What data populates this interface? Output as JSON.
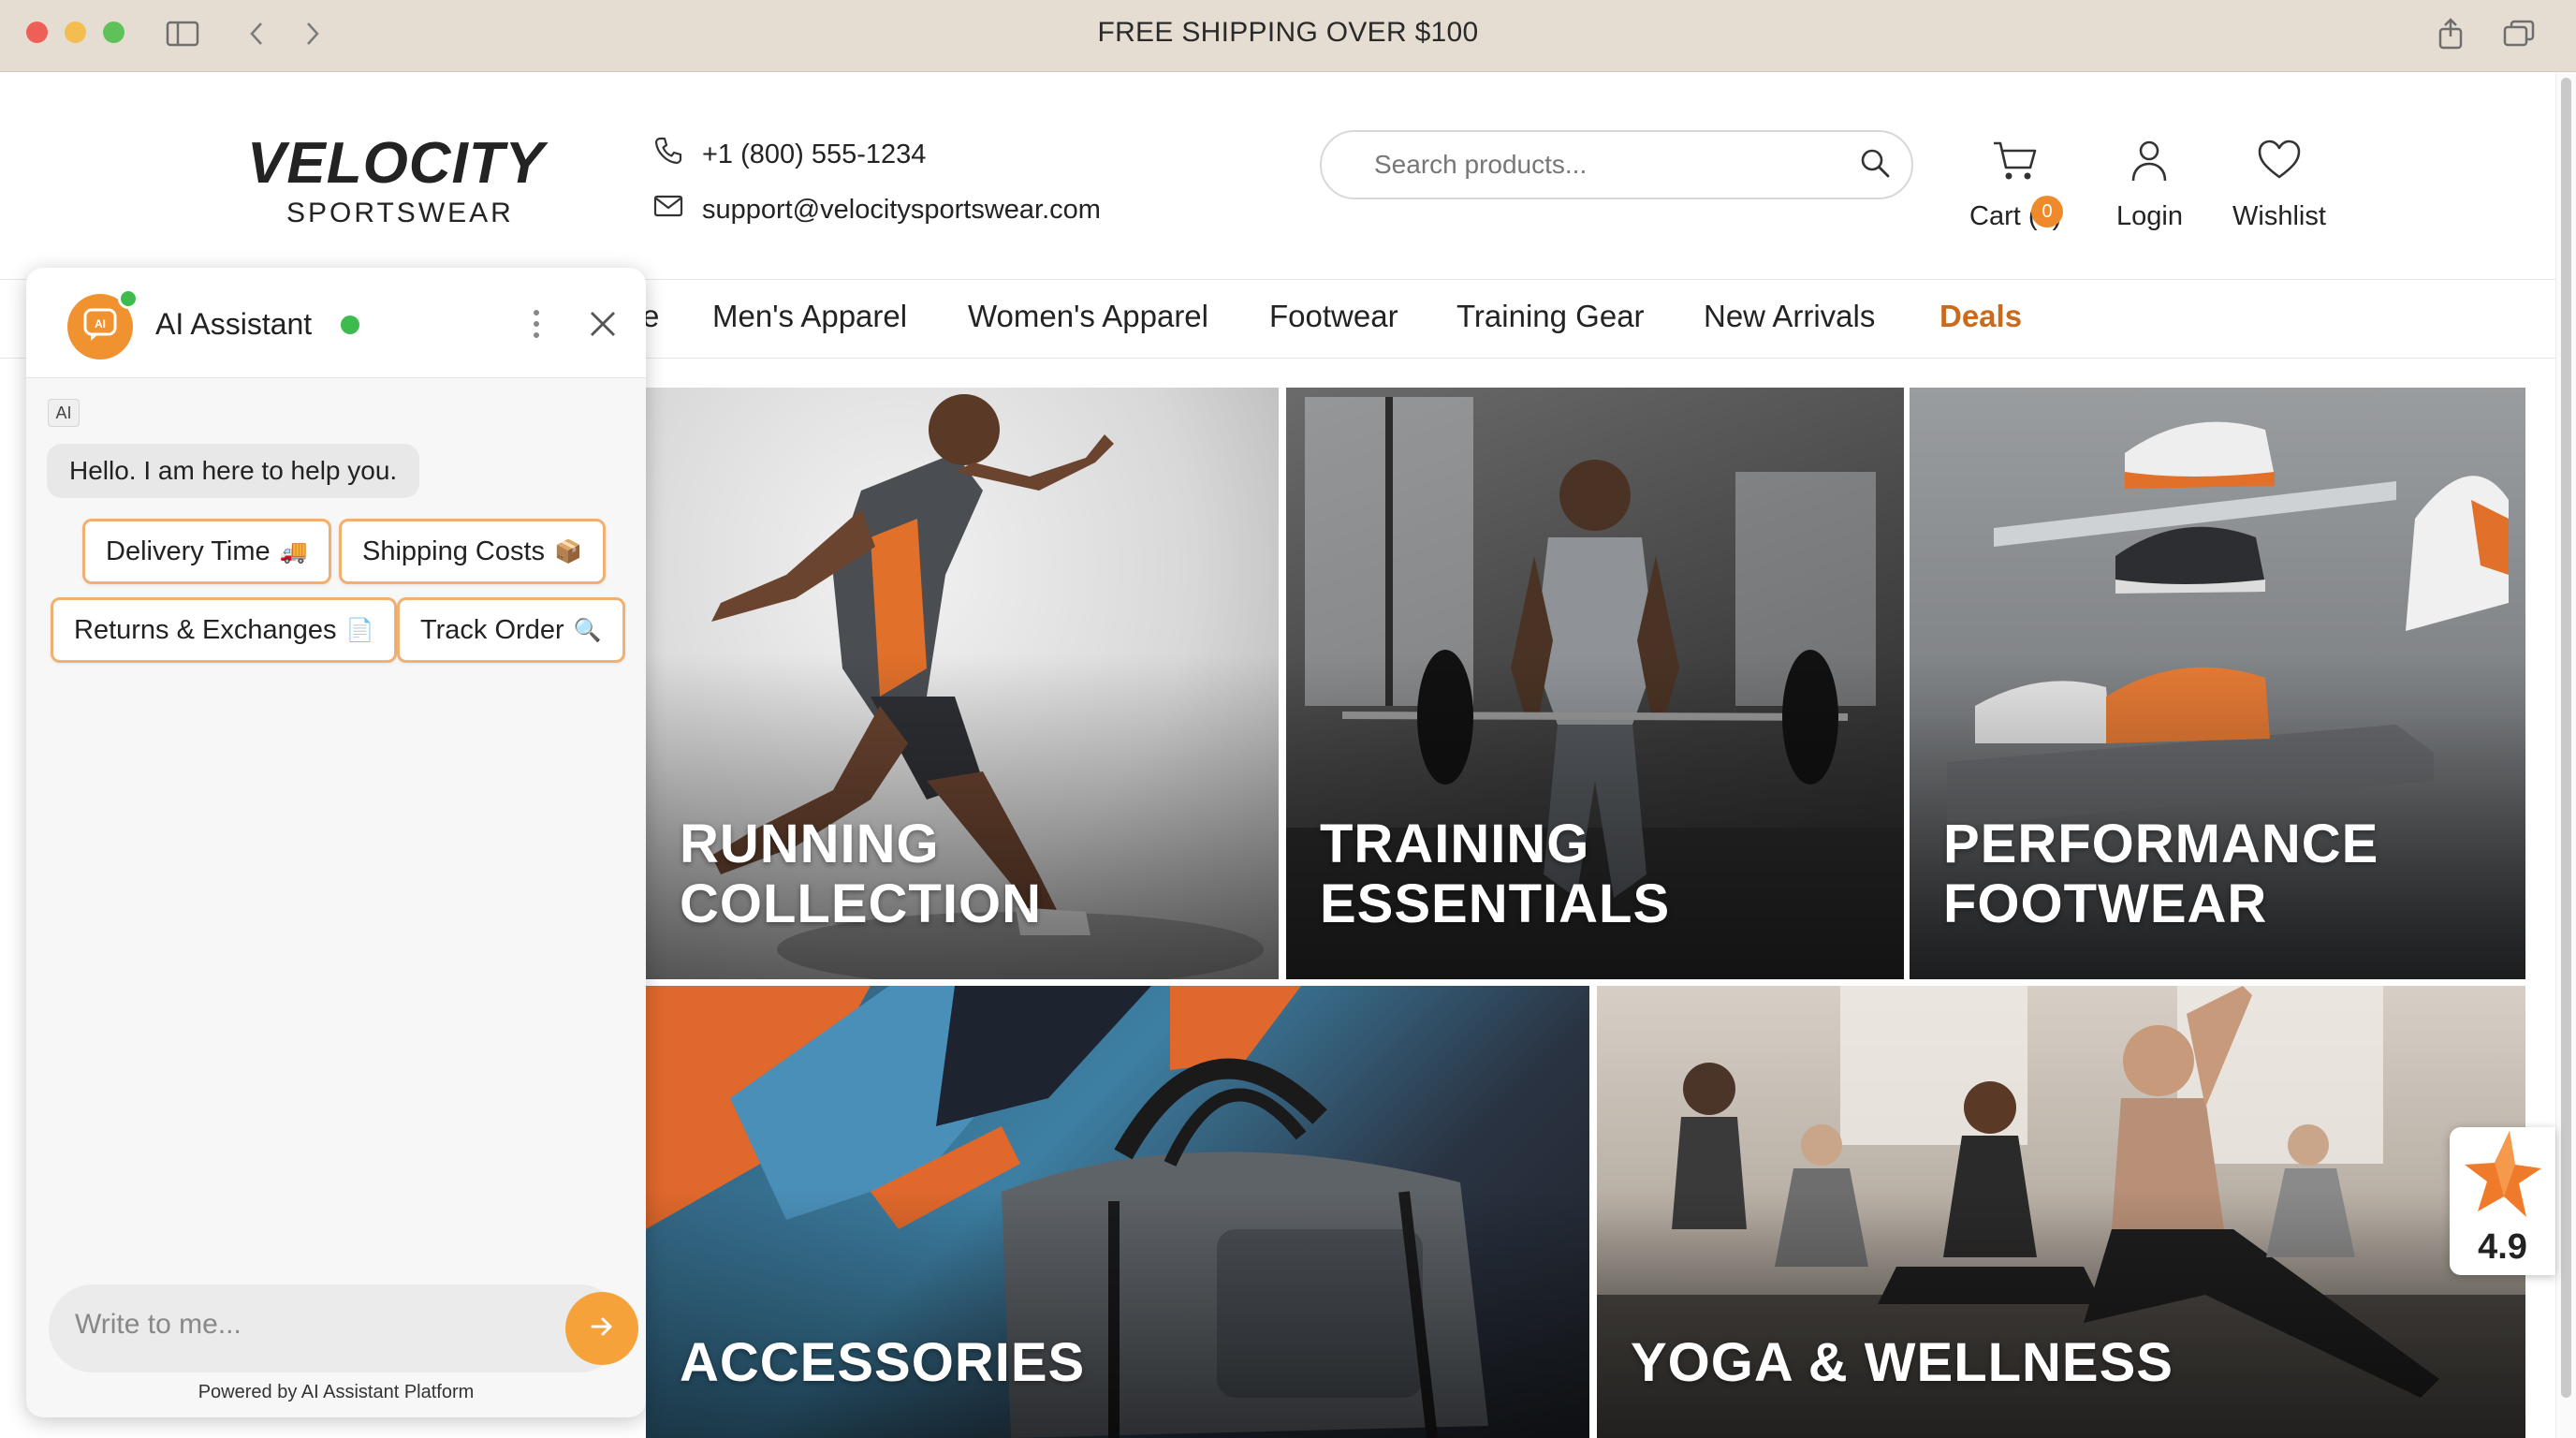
{
  "browser": {
    "title_text": "FREE SHIPPING OVER $100"
  },
  "header": {
    "logo_main": "VELOCITY",
    "logo_sub": "SPORTSWEAR",
    "phone": "+1 (800) 555-1234",
    "email": "support@velocitysportswear.com",
    "search_placeholder": "Search products...",
    "cart_count": "0",
    "cart_label": "Cart (0)",
    "login_label": "Login",
    "wishlist_label": "Wishlist"
  },
  "nav": {
    "items": [
      "e",
      "Men's Apparel",
      "Women's Apparel",
      "Footwear",
      "Training Gear",
      "New Arrivals",
      "Deals"
    ]
  },
  "tiles": [
    {
      "title": "RUNNING\nCOLLECTION"
    },
    {
      "title": "TRAINING\nESSENTIALS"
    },
    {
      "title": "PERFORMANCE\nFOOTWEAR"
    },
    {
      "title": "ACCESSORIES"
    },
    {
      "title": "YOGA & WELLNESS"
    }
  ],
  "rating": {
    "value": "4.9"
  },
  "chat": {
    "title": "AI Assistant",
    "ai_tag": "AI",
    "greeting": "Hello. I am here to help you.",
    "chips": [
      {
        "label": "Delivery Time",
        "emoji": "🚚"
      },
      {
        "label": "Shipping Costs",
        "emoji": "📦"
      },
      {
        "label": "Returns & Exchanges",
        "emoji": "📄"
      },
      {
        "label": "Track Order",
        "emoji": "🔍"
      }
    ],
    "input_placeholder": "Write to me...",
    "powered_by": "Powered by AI Assistant Platform"
  },
  "colors": {
    "accent": "#ee8a2c",
    "deals": "#c96a1c",
    "online": "#3dbb4e",
    "titlebar": "#e5ddd2"
  }
}
